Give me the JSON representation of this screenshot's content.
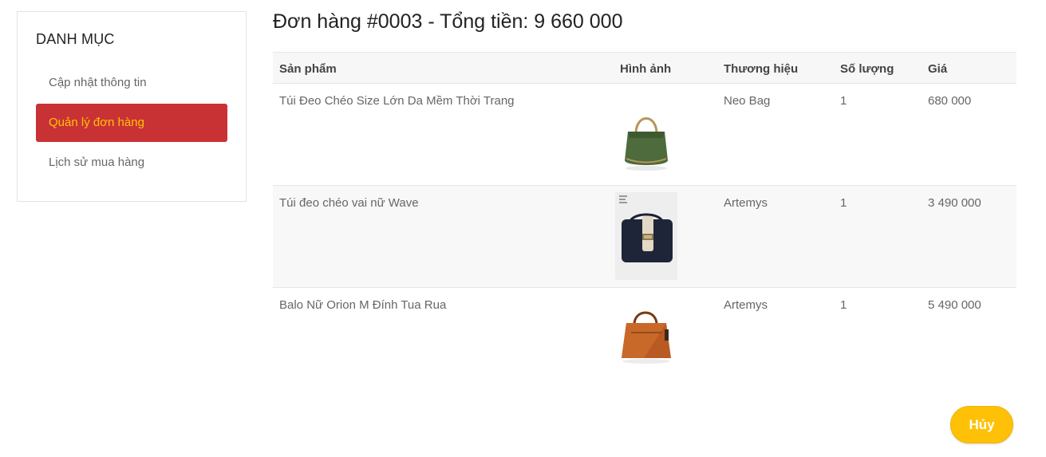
{
  "sidebar": {
    "title": "DANH MỤC",
    "items": [
      {
        "label": "Cập nhật thông tin",
        "active": false
      },
      {
        "label": "Quản lý đơn hàng",
        "active": true
      },
      {
        "label": "Lịch sử mua hàng",
        "active": false
      }
    ]
  },
  "order": {
    "title": "Đơn hàng #0003 - Tổng tiền: 9 660 000",
    "columns": [
      "Sản phẩm",
      "Hình ảnh",
      "Thương hiệu",
      "Số lượng",
      "Giá"
    ],
    "rows": [
      {
        "product": "Túi Đeo Chéo Size Lớn Da Mềm Thời Trang",
        "image_icon": "green-handbag-photo",
        "brand": "Neo Bag",
        "quantity": "1",
        "price": "680 000"
      },
      {
        "product": "Túi đeo chéo vai nữ Wave",
        "image_icon": "navy-crossbody-bag-photo",
        "brand": "Artemys",
        "quantity": "1",
        "price": "3 490 000"
      },
      {
        "product": "Balo Nữ Orion M Đính Tua Rua",
        "image_icon": "brown-tote-bag-photo",
        "brand": "Artemys",
        "quantity": "1",
        "price": "5 490 000"
      }
    ]
  },
  "actions": {
    "cancel_label": "Hủy"
  },
  "colors": {
    "accent_red": "#c93234",
    "accent_yellow": "#ffc107",
    "active_text": "#ffc107"
  }
}
